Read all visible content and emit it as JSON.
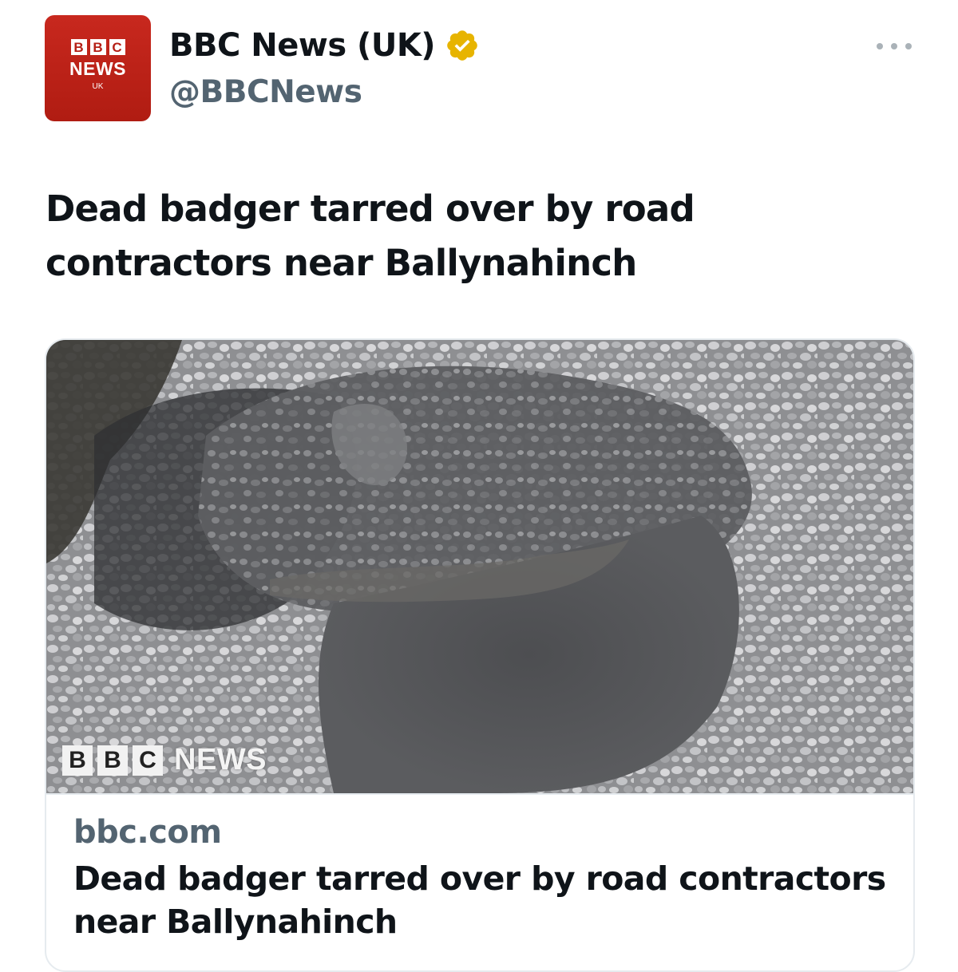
{
  "author": {
    "avatar": {
      "brand_letters": [
        "B",
        "B",
        "C"
      ],
      "news_label": "NEWS",
      "region_label": "UK",
      "bg_color": "#b91f16"
    },
    "display_name": "BBC News (UK)",
    "verified_icon": "verified-badge-icon",
    "verified_color": "#e7b400",
    "handle": "@BBCNews"
  },
  "more_icon": "more-options-icon",
  "tweet": {
    "text": "Dead badger tarred over by road contractors near Ballynahinch"
  },
  "card": {
    "image_alt": "road-gravel-photo",
    "watermark": {
      "letters": [
        "B",
        "B",
        "C"
      ],
      "label": "NEWS"
    },
    "domain": "bbc.com",
    "title": "Dead badger tarred over by road contractors near Ballynahinch"
  }
}
